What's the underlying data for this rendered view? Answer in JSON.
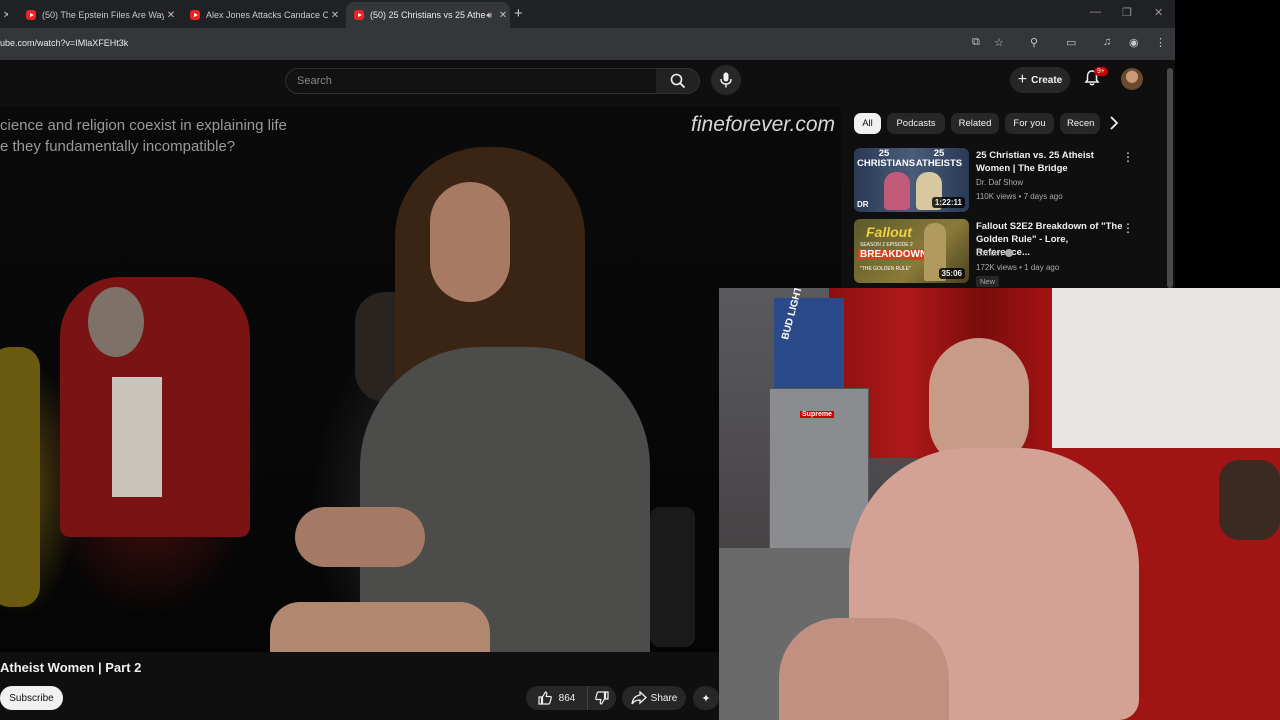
{
  "tabs": [
    {
      "title": "(50) The Epstein Files Are Way M",
      "active": false
    },
    {
      "title": "Alex Jones Attacks Candace Ow",
      "active": false
    },
    {
      "title": "(50) 25 Christians vs 25 Athe",
      "active": true,
      "audio": true
    }
  ],
  "address_bar": {
    "url": "ube.com/watch?v=IMlaXFEHt3k"
  },
  "header": {
    "search_placeholder": "Search",
    "create_label": "Create",
    "notification_count": "9+"
  },
  "video": {
    "caption_line1": "cience and religion coexist in explaining life",
    "caption_line2": "e they fundamentally incompatible?",
    "watermark": "fineforever.com",
    "title": "Atheist Women | Part 2",
    "subscribe_label": "Subscribe",
    "like_count": "864",
    "share_label": "Share"
  },
  "chips": [
    "All",
    "Podcasts",
    "Related",
    "For you",
    "Recen"
  ],
  "recommendations": [
    {
      "thumb_text_1": "25 CHRISTIANS",
      "thumb_text_2": "25 ATHEISTS",
      "duration": "1:22:11",
      "title": "25 Christian vs. 25 Atheist Women | The Bridge",
      "channel": "Dr. Daf Show",
      "meta": "110K views • 7 days ago"
    },
    {
      "thumb_text_1": "Fallout",
      "thumb_text_2": "BREAKDOWN",
      "thumb_text_3": "SEASON 2 EPISODE 2",
      "thumb_text_4": "\"THE GOLDEN RULE\"",
      "duration": "35:06",
      "title": "Fallout S2E2 Breakdown of \"The Golden Rule\" - Lore, Reference...",
      "channel": "Oxhorn",
      "meta": "172K views • 1 day ago",
      "badge": "New"
    }
  ],
  "webcam": {
    "can_label": "BUD LIGHT",
    "sticker_label": "Supreme"
  },
  "colors": {
    "brand_red": "#ff0000",
    "notif_red": "#cc0000",
    "bg": "#0f0f0f"
  }
}
